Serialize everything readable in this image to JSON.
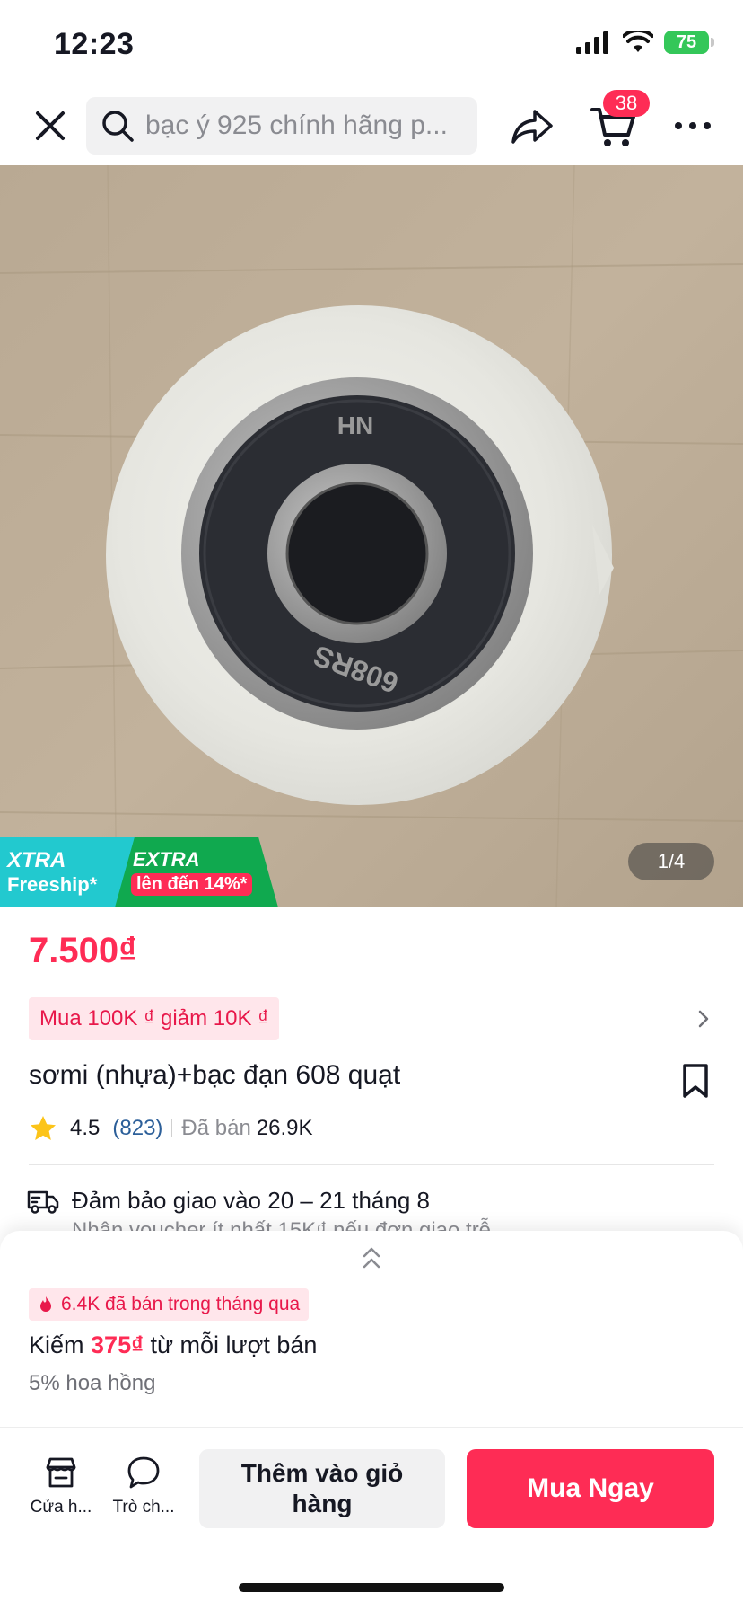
{
  "status_bar": {
    "time": "12:23",
    "battery": "75"
  },
  "nav": {
    "search_placeholder": "bạc ý 925 chính hãng p...",
    "cart_count": "38"
  },
  "gallery": {
    "counter": "1/4",
    "bearing_label_top": "NH",
    "bearing_label_bottom": "608RS"
  },
  "promo": {
    "xtra_label": "XTRA",
    "freeship_label": "Freeship*",
    "extra_label": "EXTRA",
    "extra_discount": "lên đến 14%*"
  },
  "product": {
    "price": "7.500₫",
    "voucher": "Mua 100K ₫ giảm 10K ₫",
    "title": "sơmi (nhựa)+bạc đạn 608 quạt",
    "rating": "4.5",
    "rating_count": "(823)",
    "sold_label": "Đã bán",
    "sold_count": "26.9K"
  },
  "shipping": {
    "guarantee": "Đảm bảo giao vào 20 – 21 tháng 8",
    "voucher_note": "Nhận voucher ít nhất 15K₫ nếu đơn giao trễ"
  },
  "affiliate": {
    "sold_recent": "6.4K đã bán trong tháng qua",
    "earn_prefix": "Kiếm",
    "earn_amount": "375₫",
    "earn_suffix": "từ mỗi lượt bán",
    "commission": "5% hoa hồng"
  },
  "bottom_bar": {
    "shop_label": "Cửa h...",
    "chat_label": "Trò ch...",
    "add_to_cart": "Thêm vào giỏ hàng",
    "buy_now": "Mua Ngay"
  },
  "colors": {
    "accent": "#fe2c55",
    "freeship": "#22c9cf",
    "extra": "#10a94f",
    "rating_link": "#2c5f99"
  }
}
